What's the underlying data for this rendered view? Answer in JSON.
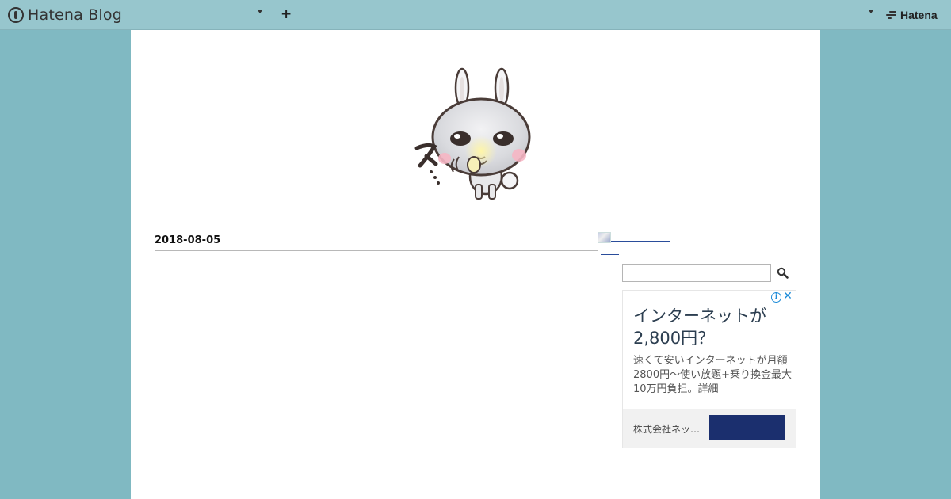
{
  "navbar": {
    "brand_label": "Hatena Blog",
    "add_label": "+",
    "hatena_label": "Hatena"
  },
  "entry": {
    "date": "2018-08-05"
  },
  "search": {
    "value": "",
    "placeholder": ""
  },
  "ad": {
    "info_glyph": "i",
    "close_glyph": "✕",
    "headline": "インターネットが2,800円？",
    "body": "速くて安いインターネットが月額2800円〜使い放題+乗り換金最大10万円負担。詳細",
    "advertiser": "株式会社ネッ…",
    "cta_color": "#1b2f6e"
  },
  "colors": {
    "background": "#80b9c2",
    "navbar": "#97c6cd",
    "content": "#ffffff",
    "link": "#2a4d9b"
  },
  "icons": {
    "brand": "hatena-blog-pen-icon",
    "caret": "caret-down-icon",
    "search": "magnifier-icon",
    "header_image": "rabbit-character-illustration"
  }
}
